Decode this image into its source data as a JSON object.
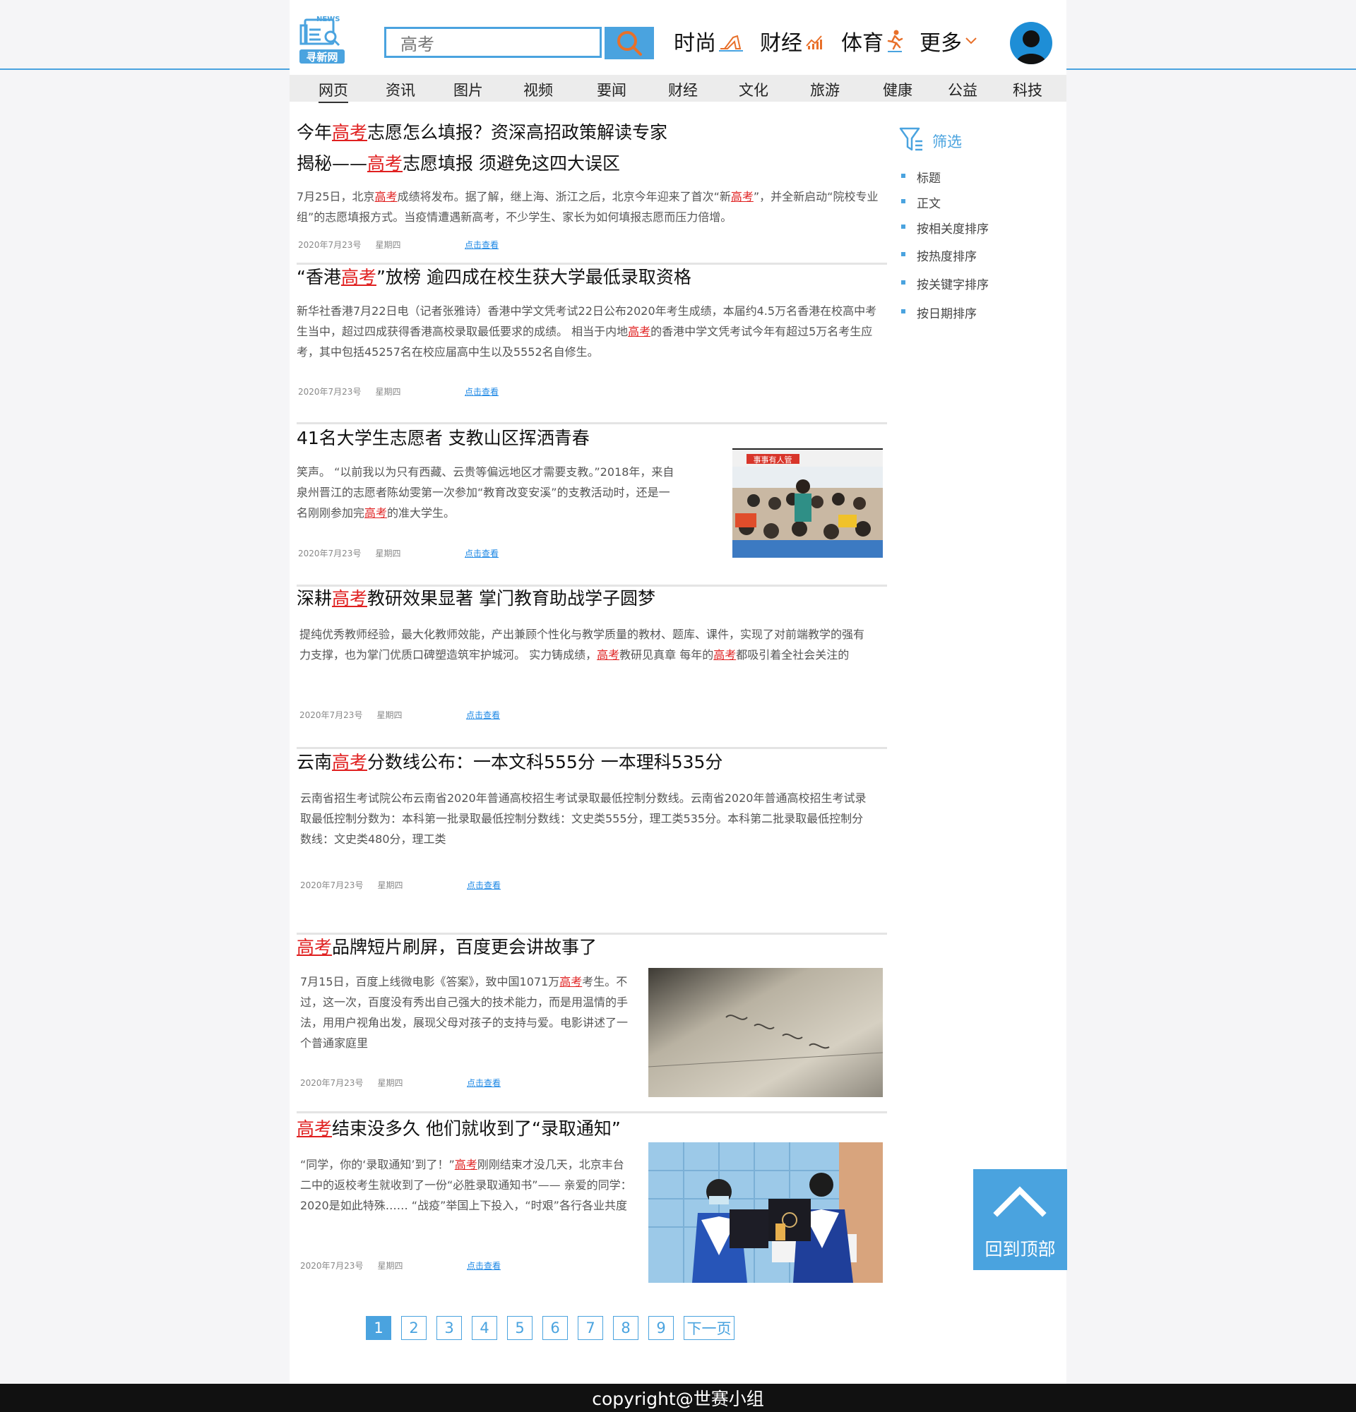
{
  "header": {
    "logo_top": "NEWS",
    "logo_text": "寻新网",
    "search": {
      "value": "高考"
    },
    "nav": [
      {
        "label": "时尚",
        "icon": "high-heel-icon"
      },
      {
        "label": "财经",
        "icon": "trend-chart-icon"
      },
      {
        "label": "体育",
        "icon": "runner-icon"
      },
      {
        "label": "更多",
        "icon": "chevron-down-icon"
      }
    ],
    "avatar": "user-avatar-icon"
  },
  "categories": [
    "网页",
    "资讯",
    "图片",
    "视频",
    "要闻",
    "财经",
    "文化",
    "旅游",
    "健康",
    "公益",
    "科技"
  ],
  "active_category": "网页",
  "keyword": "高考",
  "articles": [
    {
      "title_a_1": "今年",
      "title_a_2": "志愿怎么填报？资深高招政策解读专家",
      "title_b_1": "揭秘——",
      "title_b_2": "志愿填报 须避免这四大误区",
      "desc_1": "7月25日，北京",
      "desc_2": "成绩将发布。据了解，继上海、浙江之后，北京今年迎来了首次“新",
      "desc_3": "”，并全新启动“院校专业组”的志愿填报方式。当疫情遭遇新高考，不少学生、家长为如何填报志愿而压力倍增。",
      "date": "2020年7月23号",
      "weekday": "星期四",
      "more": "点击查看"
    },
    {
      "title_1": "“香港",
      "title_2": "”放榜 逾四成在校生获大学最低录取资格",
      "desc_1": "新华社香港7月22日电（记者张雅诗）香港中学文凭考试22日公布2020年考生成绩，本届约4.5万名香港在校高中考生当中，超过四成获得香港高校录取最低要求的成绩。 相当于内地",
      "desc_2": "的香港中学文凭考试今年有超过5万名考生应考，其中包括45257名在校应届高中生以及5552名自修生。",
      "date": "2020年7月23号",
      "weekday": "星期四",
      "more": "点击查看"
    },
    {
      "title": "41名大学生志愿者 支教山区挥洒青春",
      "desc_1": "笑声。 “以前我以为只有西藏、云贵等偏远地区才需要支教。”2018年，来自泉州晋江的志愿者陈幼雯第一次参加“教育改变安溪”的支教活动时，还是一名刚刚参加完",
      "desc_2": "的准大学生。",
      "date": "2020年7月23号",
      "weekday": "星期四",
      "more": "点击查看",
      "image_sign": "事事有人管"
    },
    {
      "title_1": "深耕",
      "title_2": "教研效果显著 掌门教育助战学子圆梦",
      "desc_1": "提纯优秀教师经验，最大化教师效能，产出兼顾个性化与教学质量的教材、题库、课件，实现了对前端教学的强有力支撑，也为掌门优质口碑塑造筑牢护城河。 实力铸成绩，",
      "desc_2": "教研见真章 每年的",
      "desc_3": "都吸引着全社会关注的",
      "date": "2020年7月23号",
      "weekday": "星期四",
      "more": "点击查看"
    },
    {
      "title_1": "云南",
      "title_2": "分数线公布：一本文科555分 一本理科535分",
      "desc": "云南省招生考试院公布云南省2020年普通高校招生考试录取最低控制分数线。云南省2020年普通高校招生考试录取最低控制分数为：本科第一批录取最低控制分数线：文史类555分，理工类535分。本科第二批录取最低控制分数线：文史类480分，理工类",
      "date": "2020年7月23号",
      "weekday": "星期四",
      "more": "点击查看"
    },
    {
      "title_2": "品牌短片刷屏，百度更会讲故事了",
      "desc_1": "7月15日，百度上线微电影《答案》，致中国1071万",
      "desc_2": "考生。不过，这一次，百度没有秀出自己强大的技术能力，而是用温情的手法，用用户视角出发，展现父母对孩子的支持与爱。电影讲述了一个普通家庭里",
      "date": "2020年7月23号",
      "weekday": "星期四",
      "more": "点击查看"
    },
    {
      "title_2": "结束没多久 他们就收到了“录取通知”",
      "desc_1": "“同学，你的‘录取通知’到了！”",
      "desc_2": "刚刚结束才没几天，北京丰台二中的返校考生就收到了一份“必胜录取通知书”—— 亲爱的同学： 2020是如此特殊…… “战疫”举国上下投入，“时艰”各行各业共度",
      "date": "2020年7月23号",
      "weekday": "星期四",
      "more": "点击查看"
    }
  ],
  "filter": {
    "title": "筛选",
    "icon": "filter-icon",
    "items": [
      "标题",
      "正文",
      "按相关度排序",
      "按热度排序",
      "按关键字排序",
      "按日期排序"
    ]
  },
  "pagination": {
    "pages": [
      "1",
      "2",
      "3",
      "4",
      "5",
      "6",
      "7",
      "8",
      "9"
    ],
    "current": "1",
    "next": "下一页"
  },
  "back_to_top": {
    "label": "回到顶部",
    "icon": "chevron-up-icon"
  },
  "footer": {
    "text": "copyright@世赛小组"
  },
  "colors": {
    "accent": "#4aa3df",
    "keyword": "#e02020",
    "search_icon": "#e8702a"
  }
}
